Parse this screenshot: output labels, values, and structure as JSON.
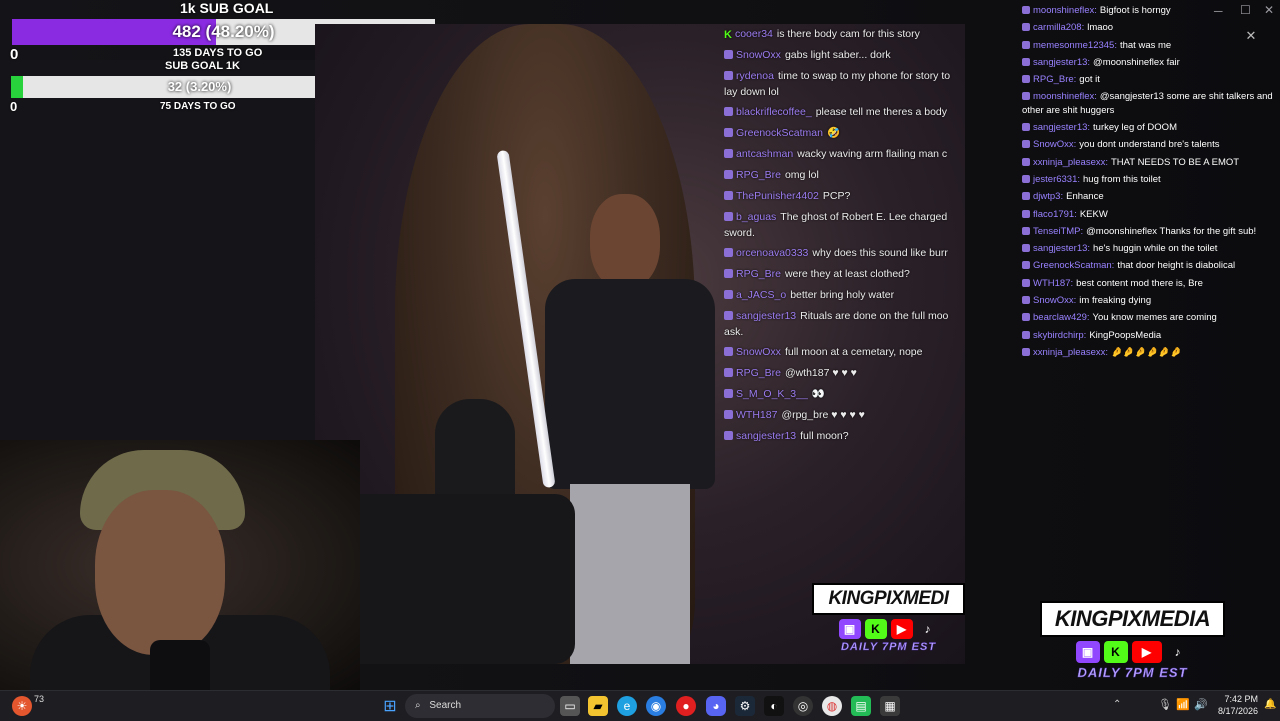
{
  "goal1": {
    "title": "1k SUB GOAL",
    "value_label": "482 (48.20%)",
    "progress": 0.482,
    "min": "0",
    "max": "1000",
    "days": "135 DAYS TO GO"
  },
  "goal2": {
    "title": "SUB GOAL 1K",
    "value_label": "32 (3.20%)",
    "progress": 0.032,
    "min": "0",
    "max": "1000",
    "days": "75 DAYS TO GO"
  },
  "colors": {
    "goal1_fill": "#8a2be2",
    "goal2_fill": "#28d23c",
    "username": "#9b7cf0",
    "kick_green": "#53fc18"
  },
  "video_chat": [
    {
      "user": "cooer34",
      "msg": "is there body cam for this story",
      "badge": "kick"
    },
    {
      "user": "SnowOxx",
      "msg": "gabs light saber... dork"
    },
    {
      "user": "rydenoa",
      "msg": "time to swap to my phone for story to lay down lol",
      "wrap": true
    },
    {
      "user": "blackriflecoffee_",
      "msg": "please tell me theres a body"
    },
    {
      "user": "GreenockScatman",
      "msg": "🤣"
    },
    {
      "user": "antcashman",
      "msg": "wacky waving arm flailing man c"
    },
    {
      "user": "RPG_Bre",
      "msg": "omg lol"
    },
    {
      "user": "ThePunisher4402",
      "msg": "PCP?"
    },
    {
      "user": "b_aguas",
      "msg": "The ghost of Robert E. Lee charged sword.",
      "wrap": true
    },
    {
      "user": "orcenoava0333",
      "msg": "why does this sound like burr"
    },
    {
      "user": "RPG_Bre",
      "msg": "were they at least clothed?"
    },
    {
      "user": "a_JACS_o",
      "msg": "better bring holy water"
    },
    {
      "user": "sangjester13",
      "msg": "Rituals are done on the full moo ask.",
      "wrap": true
    },
    {
      "user": "SnowOxx",
      "msg": "full moon at a cemetary, nope"
    },
    {
      "user": "RPG_Bre",
      "msg": "@wth187 ♥ ♥ ♥"
    },
    {
      "user": "S_M_O_K_3__",
      "msg": "👀"
    },
    {
      "user": "WTH187",
      "msg": "@rpg_bre ♥ ♥ ♥ ♥"
    },
    {
      "user": "sangjester13",
      "msg": "full moon?"
    }
  ],
  "chat": [
    {
      "user": "moonshineflex",
      "msg": "Bigfoot is horngy"
    },
    {
      "user": "carmilla208",
      "msg": "lmaoo"
    },
    {
      "user": "memesonme12345",
      "msg": "that was me"
    },
    {
      "user": "sangjester13",
      "msg": "@moonshineflex fair"
    },
    {
      "user": "RPG_Bre",
      "msg": "got it"
    },
    {
      "user": "moonshineflex",
      "msg": "@sangjester13 some are shit talkers and other are shit huggers",
      "wrap": true
    },
    {
      "user": "sangjester13",
      "msg": "turkey leg of DOOM"
    },
    {
      "user": "SnowOxx",
      "msg": "you dont understand bre's talents"
    },
    {
      "user": "xxninja_pleasexx",
      "msg": "THAT NEEDS TO BE A EMOT"
    },
    {
      "user": "jester6331",
      "msg": "hug from this toilet"
    },
    {
      "user": "djwtp3",
      "msg": "Enhance"
    },
    {
      "user": "flaco1791",
      "msg": "KEKW"
    },
    {
      "user": "TenseiTMP",
      "msg": "@moonshineflex Thanks for the gift sub!"
    },
    {
      "user": "sangjester13",
      "msg": "he's huggin while on the toilet"
    },
    {
      "user": "GreenockScatman",
      "msg": "that door height is diabolical"
    },
    {
      "user": "WTH187",
      "msg": "best content mod there is, Bre"
    },
    {
      "user": "SnowOxx",
      "msg": "im freaking dying"
    },
    {
      "user": "bearclaw429",
      "msg": "You know memes are coming"
    },
    {
      "user": "skybirdchirp",
      "msg": "KingPoopsMedia"
    },
    {
      "user": "xxninja_pleasexx",
      "msg": "🤌🤌🤌🤌🤌🤌"
    }
  ],
  "logo": {
    "name": "KINGPIXMEDIA",
    "schedule": "DAILY 7PM EST"
  },
  "logo_small": {
    "name": "KINGPIXMEDI",
    "schedule": "DAILY 7PM EST"
  },
  "taskbar": {
    "search": "Search",
    "time": "7:42 PM",
    "date": "8/17/2026",
    "weather_temp": "73"
  }
}
